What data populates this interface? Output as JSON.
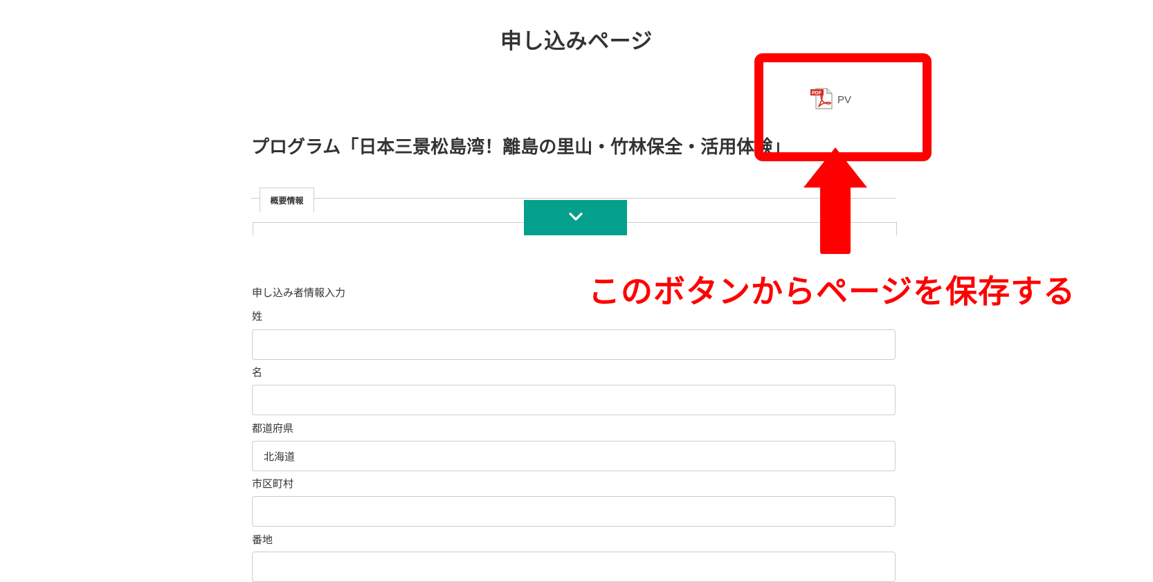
{
  "page": {
    "title": "申し込みページ",
    "pdf_button_label": "PV",
    "pdf_icon": "pdf-icon",
    "program_title": "プログラム「日本三景松島湾！離島の里山・竹林保全・活用体験」"
  },
  "tabs": [
    {
      "label": "概要情報",
      "active": true
    }
  ],
  "expand_button": {
    "icon": "chevron-down-icon",
    "color": "#05a08b"
  },
  "form": {
    "section_heading": "申し込み者情報入力",
    "fields": [
      {
        "label": "姓",
        "value": ""
      },
      {
        "label": "名",
        "value": ""
      },
      {
        "label": "都道府県",
        "value": "北海道"
      },
      {
        "label": "市区町村",
        "value": ""
      },
      {
        "label": "番地",
        "value": ""
      }
    ]
  },
  "annotation": {
    "text": "このボタンからページを保存する",
    "color": "#ff0000"
  }
}
